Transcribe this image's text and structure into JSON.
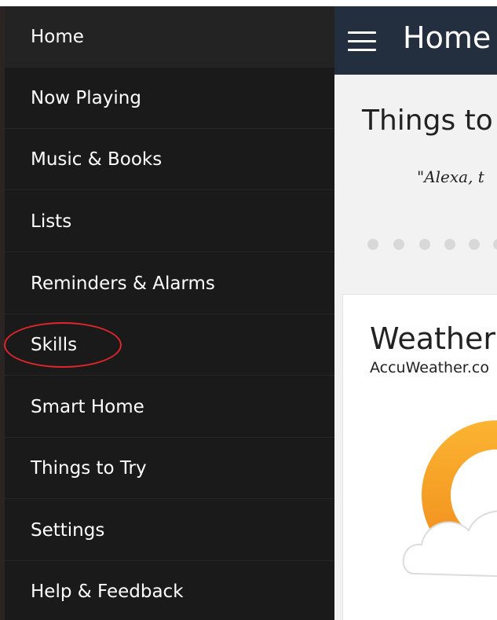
{
  "drawer": {
    "items": [
      {
        "label": "Home"
      },
      {
        "label": "Now Playing"
      },
      {
        "label": "Music & Books"
      },
      {
        "label": "Lists"
      },
      {
        "label": "Reminders & Alarms"
      },
      {
        "label": "Skills"
      },
      {
        "label": "Smart Home"
      },
      {
        "label": "Things to Try"
      },
      {
        "label": "Settings"
      },
      {
        "label": "Help & Feedback"
      }
    ]
  },
  "header": {
    "title": "Home",
    "menu_icon": "hamburger-menu-icon"
  },
  "main": {
    "section_title": "Things to",
    "quote": "\"Alexa, t",
    "carousel_dots": 6,
    "weather_card": {
      "title": "Weather",
      "source": "AccuWeather.co",
      "icon": "partly-cloudy-icon"
    }
  },
  "colors": {
    "drawer_bg": "#1a1a1a",
    "header_bg": "#232f3e",
    "annotation": "#e0262b",
    "sun": "#f7a21b"
  }
}
